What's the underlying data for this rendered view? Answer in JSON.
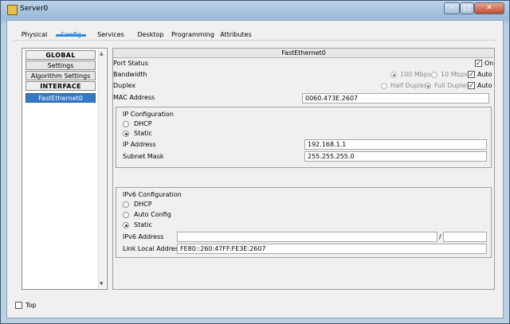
{
  "window": {
    "title": "Server0"
  },
  "tabs": [
    {
      "label": "Physical"
    },
    {
      "label": "Config"
    },
    {
      "label": "Services"
    },
    {
      "label": "Desktop"
    },
    {
      "label": "Programming"
    },
    {
      "label": "Attributes"
    }
  ],
  "sidebar": {
    "items": [
      {
        "label": "GLOBAL"
      },
      {
        "label": "Settings"
      },
      {
        "label": "Algorithm Settings"
      },
      {
        "label": "INTERFACE"
      },
      {
        "label": "FastEthernet0"
      }
    ]
  },
  "panel": {
    "title": "FastEthernet0",
    "port_status": {
      "label": "Port Status",
      "checkbox_label": "On",
      "checked": true
    },
    "bandwidth": {
      "label": "Bandwidth",
      "opt1": "100 Mbps",
      "opt2": "10 Mbps",
      "auto": "Auto",
      "auto_checked": true
    },
    "duplex": {
      "label": "Duplex",
      "opt1": "Half Duplex",
      "opt2": "Full Duplex",
      "auto": "Auto",
      "auto_checked": true
    },
    "mac": {
      "label": "MAC Address",
      "value": "0060.473E.2607"
    },
    "ip_config": {
      "title": "IP Configuration",
      "dhcp": "DHCP",
      "static": "Static",
      "selected": "Static",
      "ip_label": "IP Address",
      "ip_value": "192.168.1.1",
      "mask_label": "Subnet Mask",
      "mask_value": "255.255.255.0"
    },
    "ipv6_config": {
      "title": "IPv6 Configuration",
      "dhcp": "DHCP",
      "auto": "Auto Config",
      "static": "Static",
      "selected": "Static",
      "addr_label": "IPv6 Address",
      "addr_value": "",
      "slash": "/",
      "prefix_value": "",
      "link_label": "Link Local Address:",
      "link_value": "FE80::260:47FF:FE3E:2607"
    }
  },
  "footer": {
    "top_label": "Top",
    "top_checked": false
  }
}
